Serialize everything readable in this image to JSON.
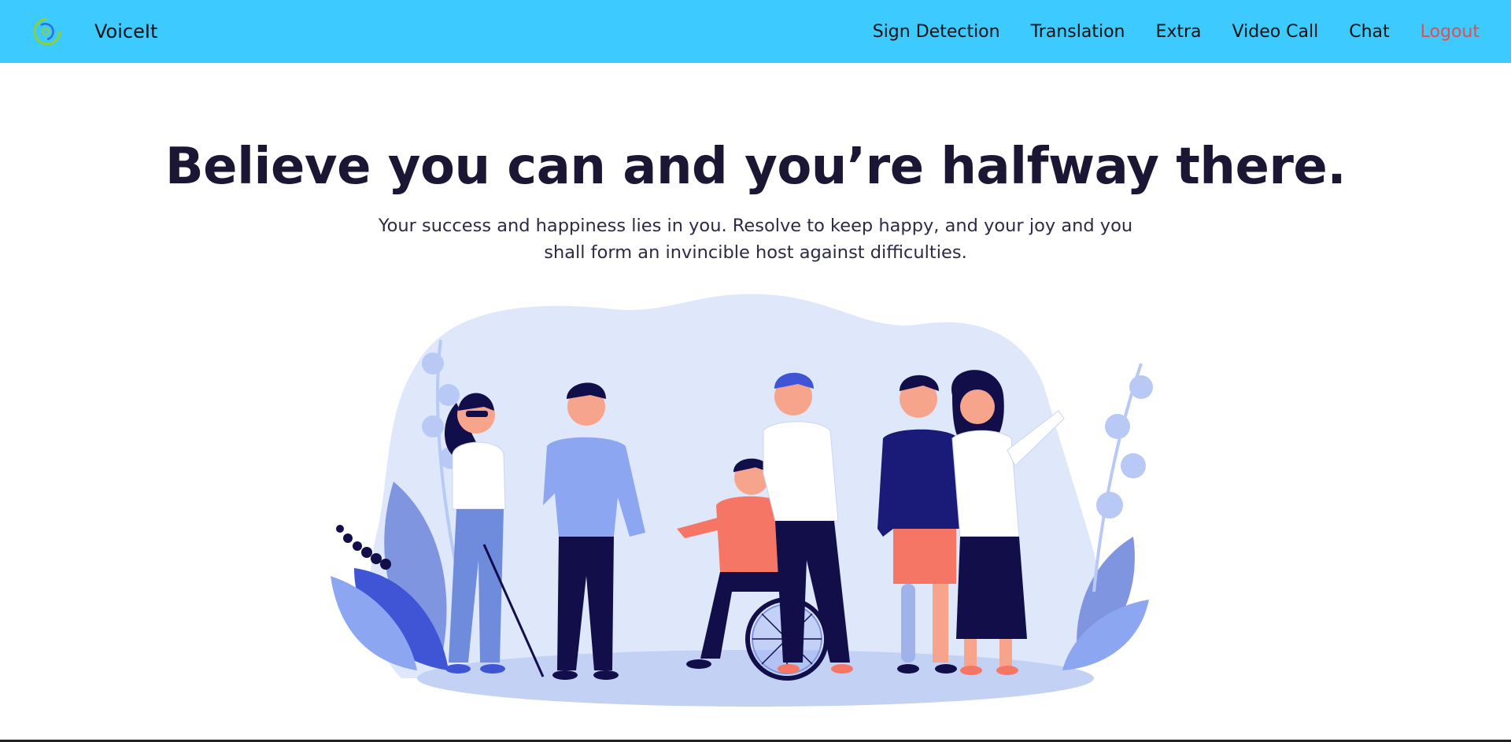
{
  "navbar": {
    "logo_icon": "voiceit-logo-icon",
    "brand_name": "VoiceIt",
    "background": "#3ccaff",
    "links": [
      {
        "label": "Sign Detection"
      },
      {
        "label": "Translation"
      },
      {
        "label": "Extra"
      },
      {
        "label": "Video Call"
      },
      {
        "label": "Chat"
      },
      {
        "label": "Logout",
        "color": "#e74c4c"
      }
    ]
  },
  "hero": {
    "title": "Believe you can and you’re halfway there.",
    "subtitle": "Your success and happiness lies in you. Resolve to keep happy, and your joy and you shall form an invincible host against difficulties."
  },
  "illustration": {
    "icon": "diverse-people-group-illustration",
    "colors": {
      "background_blob": "#dfe8fb",
      "leaves": "#8fa8f0",
      "dark_navy": "#120e4a",
      "coral": "#f57664"
    }
  }
}
